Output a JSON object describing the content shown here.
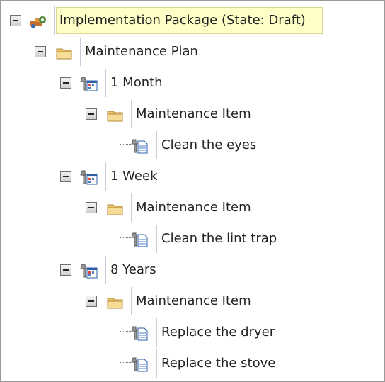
{
  "tree": {
    "root": {
      "label": "Implementation Package (State: Draft)",
      "icon": "package-gear-icon"
    },
    "plan": {
      "label": "Maintenance Plan",
      "icon": "folder-icon"
    },
    "groups": [
      {
        "label": "1 Month",
        "icon": "wrench-calendar-icon",
        "item": {
          "label": "Maintenance Item",
          "icon": "folder-icon"
        },
        "tasks": [
          {
            "label": "Clean the eyes",
            "icon": "wrench-document-icon"
          }
        ]
      },
      {
        "label": "1 Week",
        "icon": "wrench-calendar-icon",
        "item": {
          "label": "Maintenance Item",
          "icon": "folder-icon"
        },
        "tasks": [
          {
            "label": "Clean the lint trap",
            "icon": "wrench-document-icon"
          }
        ]
      },
      {
        "label": "8 Years",
        "icon": "wrench-calendar-icon",
        "item": {
          "label": "Maintenance Item",
          "icon": "folder-icon"
        },
        "tasks": [
          {
            "label": "Replace the dryer",
            "icon": "wrench-document-icon"
          },
          {
            "label": "Replace the stove",
            "icon": "wrench-document-icon"
          }
        ]
      }
    ]
  }
}
